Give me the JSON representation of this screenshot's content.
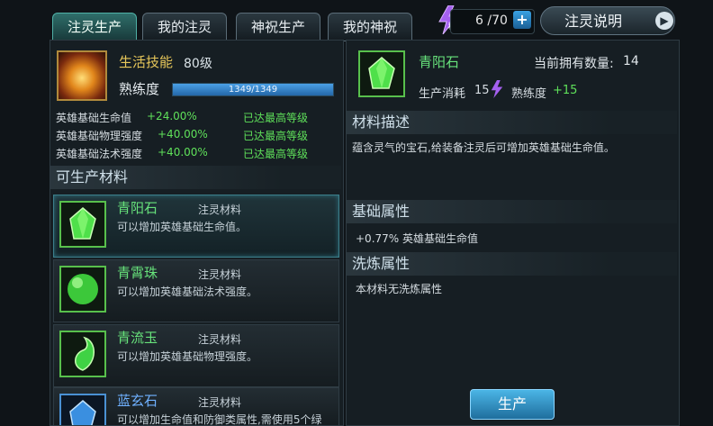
{
  "tabs": [
    {
      "label": "注灵生产",
      "active": true
    },
    {
      "label": "我的注灵",
      "active": false
    },
    {
      "label": "神祝生产",
      "active": false
    },
    {
      "label": "我的神祝",
      "active": false
    }
  ],
  "energy": {
    "value": "6 /70",
    "icon_label": "精"
  },
  "help_button": "注灵说明",
  "skill": {
    "title": "生活技能",
    "level": "80级",
    "proficiency_label": "熟练度",
    "proficiency": "1349/1349",
    "progress_fraction": 1.0
  },
  "bonuses": [
    {
      "name": "英雄基础生命值",
      "value": "+24.00%",
      "status": "已达最高等级"
    },
    {
      "name": "英雄基础物理强度",
      "value": "+40.00%",
      "status": "已达最高等级"
    },
    {
      "name": "英雄基础法术强度",
      "value": "+40.00%",
      "status": "已达最高等级"
    }
  ],
  "materials_header": "可生产材料",
  "materials": [
    {
      "name": "青阳石",
      "type": "注灵材料",
      "desc": "可以增加英雄基础生命值。",
      "color": "#5fe05a",
      "icon": "green-crystal-icon"
    },
    {
      "name": "青霄珠",
      "type": "注灵材料",
      "desc": "可以增加英雄基础法术强度。",
      "color": "#5fe05a",
      "icon": "green-orb-icon"
    },
    {
      "name": "青流玉",
      "type": "注灵材料",
      "desc": "可以增加英雄基础物理强度。",
      "color": "#5fe05a",
      "icon": "green-jade-icon"
    },
    {
      "name": "蓝玄石",
      "type": "注灵材料",
      "desc": "可以增加生命值和防御类属性,需使用5个绿",
      "color": "#4a91d4",
      "icon": "blue-crystal-icon"
    }
  ],
  "detail": {
    "name": "青阳石",
    "owned_label": "当前拥有数量:",
    "owned_value": "14",
    "cost_label": "生产消耗",
    "cost_value": "15",
    "prof_label": "熟练度",
    "prof_value": "+15",
    "desc_header": "材料描述",
    "desc": "蕴含灵气的宝石,给装备注灵后可增加英雄基础生命值。",
    "base_header": "基础属性",
    "base_value": "+0.77% 英雄基础生命值",
    "wash_header": "洗炼属性",
    "wash_value": "本材料无洗炼属性"
  },
  "produce_button": "生产"
}
